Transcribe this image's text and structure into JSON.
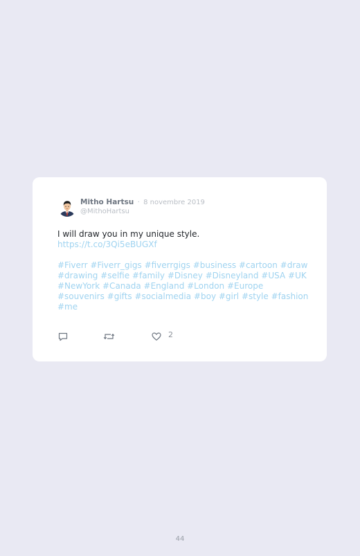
{
  "tweet": {
    "author_name": "Mitho Hartsu",
    "separator": "·",
    "date": "8 novembre 2019",
    "handle": "@MithoHartsu",
    "text": "I will draw you in my unique style.",
    "link": "https://t.co/3Qi5eBUGXf",
    "hashtag_lines": [
      "#Fiverr #Fiverr_gigs #fiverrgigs #business #cartoon #draw",
      "#drawing #selfie #family #Disney #Disneyland #USA #UK",
      "#NewYork #Canada #England #London #Europe",
      "#souvenirs #gifts #socialmedia #boy #girl #style #fashion",
      "#me"
    ],
    "actions": {
      "reply_icon": "reply-icon",
      "retweet_icon": "retweet-icon",
      "like_icon": "heart-icon",
      "like_count": "2"
    },
    "colors": {
      "hashtag": "#9fd3f0",
      "background": "#e9e9f3",
      "card": "#ffffff"
    }
  },
  "page": {
    "number": "44"
  }
}
